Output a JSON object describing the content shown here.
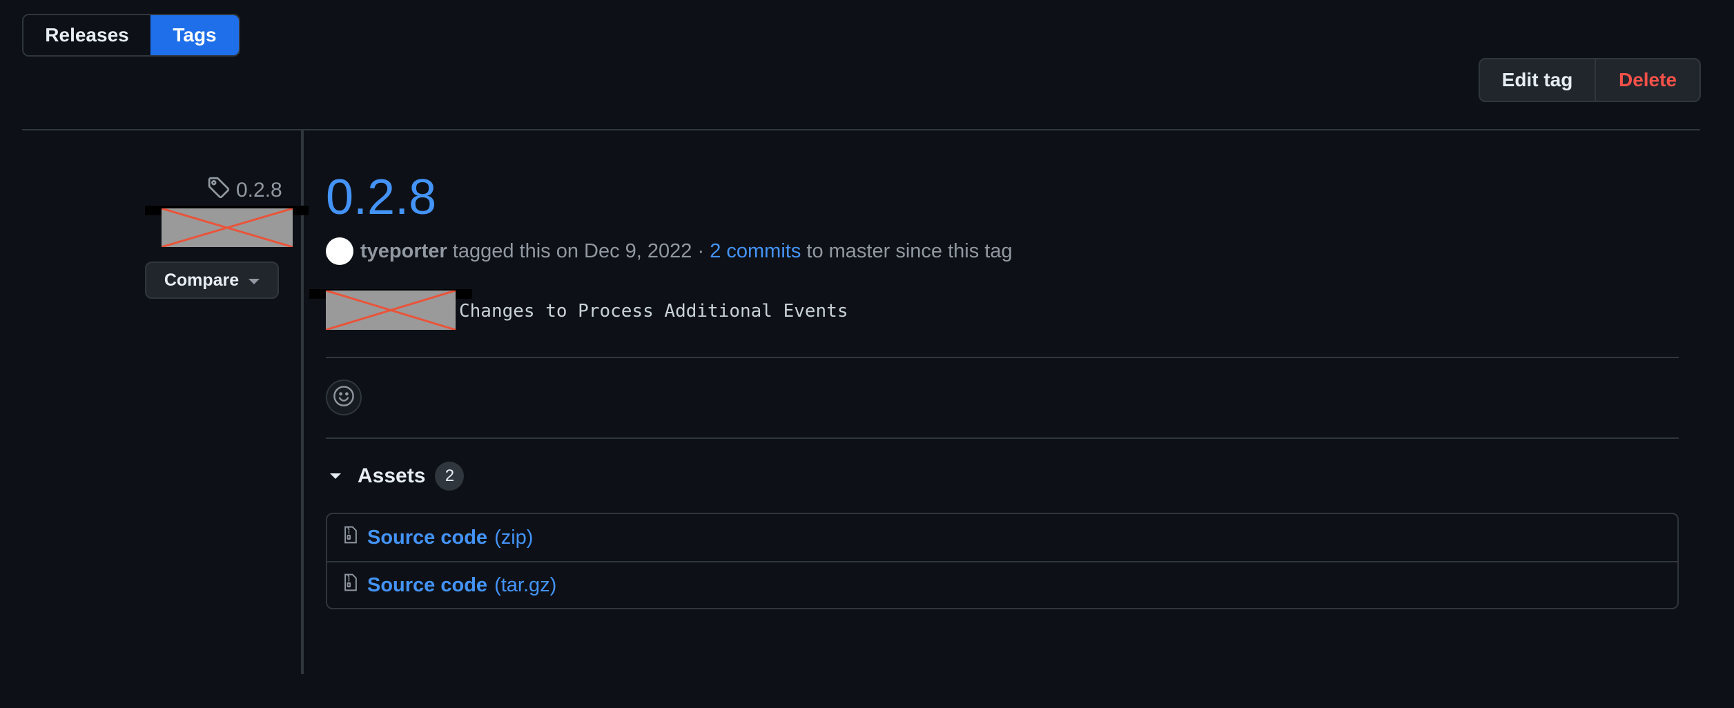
{
  "tabs": {
    "releases": "Releases",
    "tags": "Tags"
  },
  "actions": {
    "edit": "Edit tag",
    "delete": "Delete"
  },
  "sidebar": {
    "tag_name": "0.2.8",
    "compare_label": "Compare"
  },
  "release": {
    "title": "0.2.8",
    "author": "tyeporter",
    "tagged_text": " tagged this on Dec 9, 2022 · ",
    "commits_link": "2 commits",
    "since_text": " to master since this tag",
    "body": "Changes to Process Additional Events"
  },
  "assets": {
    "label": "Assets",
    "count": "2",
    "items": [
      {
        "name": "Source code",
        "ext": "(zip)"
      },
      {
        "name": "Source code",
        "ext": "(tar.gz)"
      }
    ]
  },
  "colors": {
    "background": "#0d1117",
    "accent": "#4493f8",
    "primary_button": "#1f6feb",
    "danger": "#f85149",
    "border": "#30363d"
  },
  "icons": [
    "tag-icon",
    "chevron-down-icon",
    "smiley-icon",
    "triangle-down-icon",
    "file-zip-icon"
  ]
}
